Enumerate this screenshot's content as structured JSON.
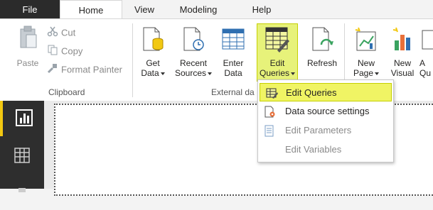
{
  "tabs": [
    {
      "label": "File"
    },
    {
      "label": "Home"
    },
    {
      "label": "View"
    },
    {
      "label": "Modeling"
    },
    {
      "label": "Help"
    }
  ],
  "clipboard": {
    "paste": "Paste",
    "cut": "Cut",
    "copy": "Copy",
    "format_painter": "Format Painter",
    "group_label": "Clipboard"
  },
  "external_data": {
    "get_data_line1": "Get",
    "get_data_line2": "Data",
    "recent_line1": "Recent",
    "recent_line2": "Sources",
    "enter_line1": "Enter",
    "enter_line2": "Data",
    "edit_line1": "Edit",
    "edit_line2": "Queries",
    "refresh": "Refresh",
    "group_label": "External da"
  },
  "insert": {
    "new_page_line1": "New",
    "new_page_line2": "Page",
    "new_visual_line1": "New",
    "new_visual_line2": "Visual",
    "ask_line1": "A",
    "ask_line2": "Qu"
  },
  "menu": {
    "items": [
      {
        "label": "Edit Queries"
      },
      {
        "label": "Data source settings"
      },
      {
        "label": "Edit Parameters"
      },
      {
        "label": "Edit Variables"
      }
    ]
  },
  "colors": {
    "highlight": "#f0f464",
    "accent": "#f2c811"
  }
}
